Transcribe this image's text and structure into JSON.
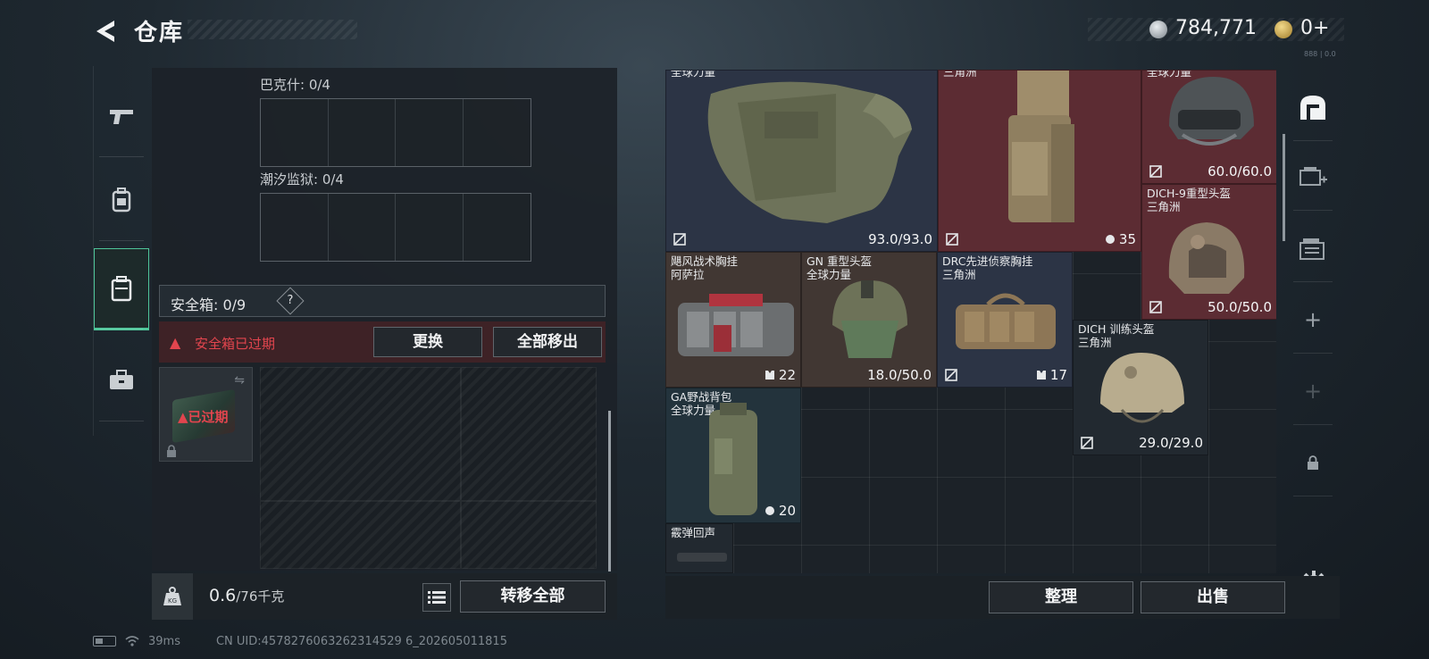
{
  "header": {
    "title": "仓库",
    "currency_silver": "784,771",
    "currency_gold": "0+",
    "ticker": "888 | 0.0"
  },
  "left_panel": {
    "slot1_label": "巴克什: 0/4",
    "slot2_label": "潮汐监狱: 0/4",
    "safebox_label": "安全箱:  0/9",
    "safebox_help": "?",
    "expired_warning": "安全箱已过期",
    "swap_button": "更换",
    "remove_all_button": "全部移出",
    "expired_badge": "已过期",
    "weight_current": "0.6",
    "weight_max": "/76千克",
    "transfer_all_button": "转移全部"
  },
  "stash_items": [
    {
      "name": "全球力量",
      "value": "93.0/93.0"
    },
    {
      "name": "三角洲",
      "value": "35"
    },
    {
      "name": "全球力量",
      "value": "60.0/60.0"
    },
    {
      "name": "DICH-9重型头盔\n三角洲",
      "value": "50.0/50.0"
    },
    {
      "name": "飓风战术胸挂\n阿萨拉",
      "value": "22"
    },
    {
      "name": "GN 重型头盔\n全球力量",
      "value": "18.0/50.0"
    },
    {
      "name": "DRC先进侦察胸挂\n三角洲",
      "value": "17"
    },
    {
      "name": "DICH 训练头盔\n三角洲",
      "value": "29.0/29.0"
    },
    {
      "name": "GA野战背包\n全球力量",
      "value": "20"
    },
    {
      "name": "霰弹回声",
      "value": ""
    }
  ],
  "stash_footer": {
    "sort_button": "整理",
    "sell_button": "出售"
  },
  "status": {
    "ping": "39ms",
    "uid": "CN UID:4578276063262314529 6_202605011815"
  }
}
